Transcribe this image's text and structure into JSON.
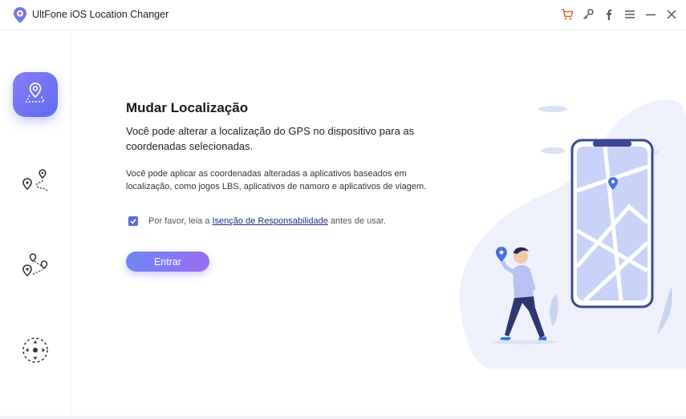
{
  "window": {
    "title": "UltFone iOS Location Changer"
  },
  "titlebar_icons": [
    "cart-icon",
    "key-icon",
    "facebook-icon",
    "menu-icon",
    "minimize-icon",
    "close-icon"
  ],
  "sidebar": {
    "items": [
      {
        "name": "change-location",
        "icon": "location-pin-map-icon",
        "active": true
      },
      {
        "name": "two-spot-mode",
        "icon": "two-pins-route-icon",
        "active": false
      },
      {
        "name": "multi-spot-mode",
        "icon": "multi-pins-route-icon",
        "active": false
      },
      {
        "name": "joystick-mode",
        "icon": "joystick-icon",
        "active": false
      }
    ]
  },
  "main": {
    "heading": "Mudar Localização",
    "description": "Você pode alterar a localização do GPS no dispositivo para as coordenadas selecionadas.",
    "note": "Você pode aplicar as coordenadas alteradas a aplicativos baseados em localização, como jogos LBS, aplicativos de namoro e aplicativos de viagem.",
    "consent": {
      "checked": true,
      "prefix": "Por favor, leia a ",
      "link": "Isenção de Responsabilidade",
      "suffix": " antes de usar."
    },
    "enter_button": "Entrar"
  },
  "colors": {
    "accent": "#6c74f0",
    "accent_dark": "#3f4a9e",
    "link": "#1f2d8c",
    "illustration_bg": "#eef1fb"
  }
}
